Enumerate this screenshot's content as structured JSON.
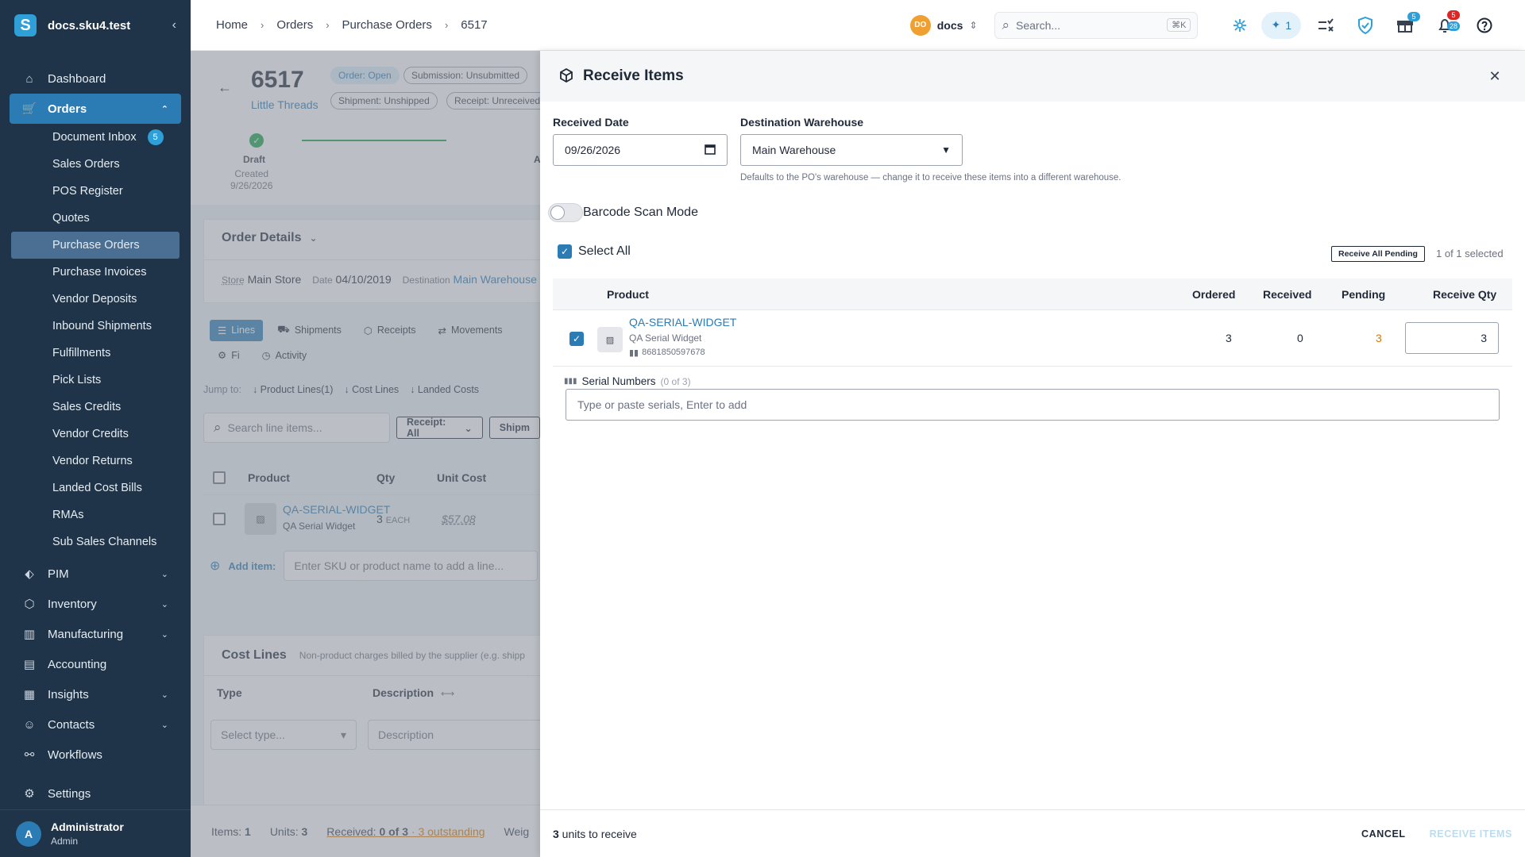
{
  "app": {
    "name": "docs.sku4.test",
    "logo_letter": "S",
    "collapse_glyph": "‹"
  },
  "sidebar": {
    "items": [
      {
        "key": "dashboard",
        "label": "Dashboard",
        "icon": "⌂"
      },
      {
        "key": "orders",
        "label": "Orders",
        "icon": "🛒",
        "chev": "⌃"
      }
    ],
    "orders_sub": [
      {
        "label": "Document Inbox",
        "badge": "5"
      },
      {
        "label": "Sales Orders"
      },
      {
        "label": "POS Register"
      },
      {
        "label": "Quotes"
      },
      {
        "label": "Purchase Orders"
      },
      {
        "label": "Purchase Invoices"
      },
      {
        "label": "Vendor Deposits"
      },
      {
        "label": "Inbound Shipments"
      },
      {
        "label": "Fulfillments"
      },
      {
        "label": "Pick Lists"
      },
      {
        "label": "Sales Credits"
      },
      {
        "label": "Vendor Credits"
      },
      {
        "label": "Vendor Returns"
      },
      {
        "label": "Landed Cost Bills"
      },
      {
        "label": "RMAs"
      },
      {
        "label": "Sub Sales Channels"
      }
    ],
    "lower": [
      {
        "label": "PIM",
        "icon": "⬖",
        "chev": "⌄"
      },
      {
        "label": "Inventory",
        "icon": "⬡",
        "chev": "⌄"
      },
      {
        "label": "Manufacturing",
        "icon": "▥",
        "chev": "⌄"
      },
      {
        "label": "Accounting",
        "icon": "▤"
      },
      {
        "label": "Insights",
        "icon": "▦",
        "chev": "⌄"
      },
      {
        "label": "Contacts",
        "icon": "☺",
        "chev": "⌄"
      },
      {
        "label": "Workflows",
        "icon": "⚯"
      }
    ],
    "settings": {
      "label": "Settings",
      "icon": "⚙"
    },
    "user": {
      "initial": "A",
      "name": "Administrator",
      "role": "Admin"
    }
  },
  "topbar": {
    "breadcrumbs": [
      "Home",
      "Orders",
      "Purchase Orders",
      "6517"
    ],
    "sep": "›",
    "org": {
      "initials": "DO",
      "name": "docs",
      "toggle": "⇕"
    },
    "search": {
      "placeholder": "Search...",
      "shortcut": "⌘K",
      "icon": "⌕"
    },
    "ai_count": "1",
    "gift_badge": "5",
    "bell_badge_top": "5",
    "bell_badge_bottom": "28",
    "colors": {
      "accent": "#2b7bb4",
      "sidebar": "#1f3448"
    }
  },
  "po": {
    "back_glyph": "←",
    "number": "6517",
    "vendor": "Little Threads",
    "chips": {
      "order": "Order: Open",
      "submission": "Submission: Unsubmitted",
      "shipment": "Shipment: Unshipped",
      "receipt": "Receipt: Unreceived"
    },
    "step": {
      "label": "Draft",
      "created": "Created",
      "date": "9/26/2026",
      "next_initial": "A"
    },
    "details": {
      "title": "Order Details",
      "store_label": "Store",
      "store": "Main Store",
      "date_label": "Date",
      "date": "04/10/2019",
      "dest_label": "Destination",
      "dest": "Main Warehouse"
    },
    "tabs": [
      "Lines",
      "Shipments",
      "Receipts",
      "Movements",
      "Fi",
      "Activity"
    ],
    "jump": {
      "label": "Jump to:",
      "links": [
        "Product Lines(1)",
        "Cost Lines",
        "Landed Costs"
      ]
    },
    "filter": {
      "search_placeholder": "Search line items...",
      "receipt_btn": "Receipt: All",
      "shipment_btn": "Shipm"
    },
    "lines_head": {
      "product": "Product",
      "qty": "Qty",
      "unit_cost": "Unit Cost"
    },
    "line": {
      "sku": "QA-SERIAL-WIDGET",
      "name": "QA Serial Widget",
      "qty": "3",
      "uom": "EACH",
      "cost": "$57.08"
    },
    "add_item": {
      "label": "Add item:",
      "placeholder": "Enter SKU or product name to add a line..."
    },
    "cost_lines": {
      "title": "Cost Lines",
      "desc": "Non-product charges billed by the supplier (e.g. shipp",
      "type_head": "Type",
      "desc_head": "Description",
      "type_placeholder": "Select type...",
      "desc_placeholder": "Description"
    },
    "bottom": {
      "items_label": "Items:",
      "items": "1",
      "units_label": "Units:",
      "units": "3",
      "received_label": "Received:",
      "received": "0 of 3",
      "outstanding": "· 3 outstanding",
      "weight": "Weig"
    }
  },
  "drawer": {
    "title": "Receive Items",
    "close_glyph": "✕",
    "received_date_label": "Received Date",
    "received_date": "09/26/2026",
    "warehouse_label": "Destination Warehouse",
    "warehouse": "Main Warehouse",
    "warehouse_hint": "Defaults to the PO's warehouse — change it to receive these items into a different warehouse.",
    "barcode_mode": "Barcode Scan Mode",
    "select_all": "Select All",
    "receive_all": "Receive All Pending",
    "selected_count": "1 of 1 selected",
    "columns": {
      "product": "Product",
      "ordered": "Ordered",
      "received": "Received",
      "pending": "Pending",
      "receive_qty": "Receive Qty"
    },
    "row": {
      "sku": "QA-SERIAL-WIDGET",
      "name": "QA Serial Widget",
      "barcode": "8681850597678",
      "ordered": "3",
      "received": "0",
      "pending": "3",
      "receive_qty": "3"
    },
    "serial": {
      "label": "Serial Numbers",
      "count": "(0 of 3)",
      "placeholder": "Type or paste serials, Enter to add"
    },
    "footer": {
      "units_count": "3",
      "units_text": " units to receive",
      "cancel": "CANCEL",
      "receive": "RECEIVE ITEMS"
    }
  }
}
